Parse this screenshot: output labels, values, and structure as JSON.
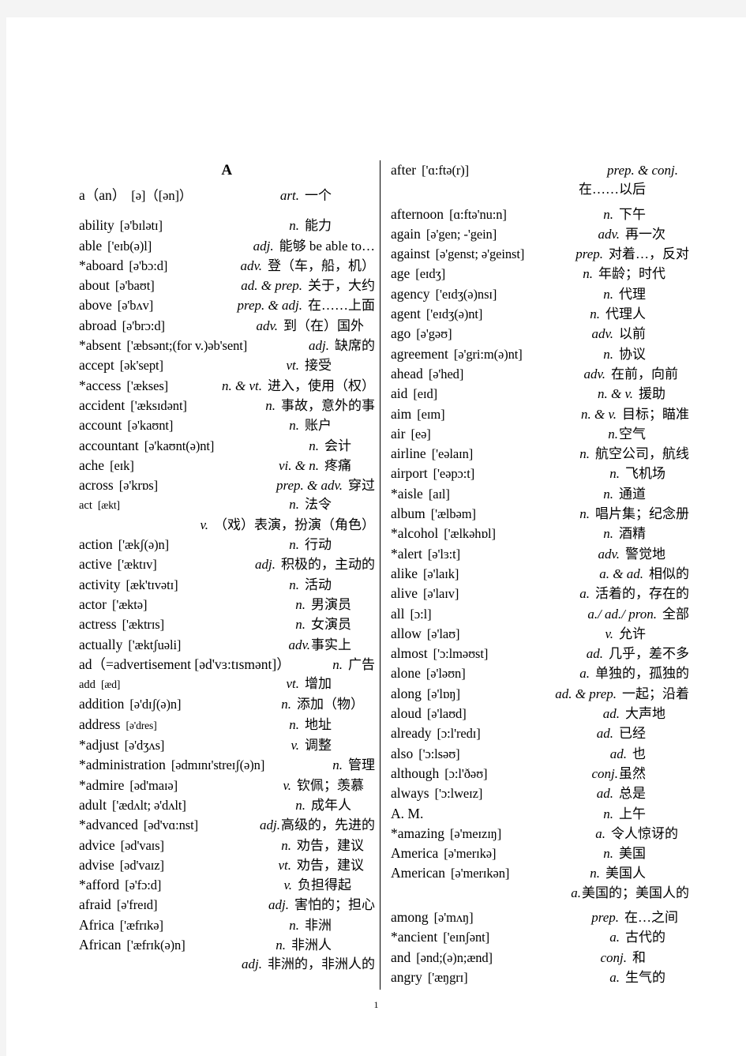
{
  "page": {
    "section_letter": "A",
    "page_number": "1"
  },
  "left_column": [
    {
      "word": "a（an）",
      "phonetic": "[ə]（[ən]）",
      "pos": "art.",
      "def": "一个",
      "spacing": "none",
      "tail_pad": "pad-right-55"
    },
    {
      "word": "ability",
      "phonetic": "[ə'bɪlətɪ]",
      "pos": "n.",
      "def": "能力",
      "spacing": "gap-top",
      "tail_pad": "pad-right-55"
    },
    {
      "word": "able",
      "phonetic": "['eɪb(ə)l]",
      "pos": "adj.",
      "def": "能够 be able to…",
      "spacing": "none",
      "tail_pad": ""
    },
    {
      "word": "*aboard",
      "phonetic": "[ə'bɔ:d]",
      "pos": "adv.",
      "def": "登（车，船，机）",
      "spacing": "none",
      "tail_pad": ""
    },
    {
      "word": "about",
      "phonetic": "[ə'baʊt]",
      "pos": "ad. & prep.",
      "def": "关于，大约",
      "spacing": "none",
      "tail_pad": ""
    },
    {
      "word": "above",
      "phonetic": "[ə'bʌv]",
      "pos": "prep. & adj.",
      "def": "在……上面",
      "spacing": "none",
      "tail_pad": ""
    },
    {
      "word": "abroad",
      "phonetic": "[ə'brɔ:d]",
      "pos": "adv.",
      "def": "到（在）国外",
      "spacing": "none",
      "tail_pad": "pad-right-14"
    },
    {
      "word": "*absent",
      "phonetic": "['æbsənt;(for v.)əb'sent]",
      "pos": "adj.",
      "def": "缺席的",
      "spacing": "none",
      "tail_pad": ""
    },
    {
      "word": "accept",
      "phonetic": "[ək'sept]",
      "pos": "vt.",
      "def": "接受",
      "spacing": "none",
      "tail_pad": "pad-right-55"
    },
    {
      "word": "*access",
      "phonetic": "['ækses]",
      "pos": "n. & vt.",
      "def": "进入，使用（权）",
      "spacing": "none",
      "tail_pad": ""
    },
    {
      "word": "accident",
      "phonetic": "['æksɪdənt]",
      "pos": "n.",
      "def": "事故，意外的事",
      "spacing": "none",
      "tail_pad": ""
    },
    {
      "word": "account",
      "phonetic": "[ə'kaʊnt]",
      "pos": "n.",
      "def": "账户",
      "spacing": "none",
      "tail_pad": "pad-right-55"
    },
    {
      "word": "accountant",
      "phonetic": "[ə'kaʊnt(ə)nt]",
      "pos": "n.",
      "def": "会计",
      "spacing": "none",
      "tail_pad": "pad-right-30"
    },
    {
      "word": "ache",
      "phonetic": "[eɪk]",
      "pos": "vi. & n.",
      "def": "疼痛",
      "spacing": "none",
      "tail_pad": "pad-right-30"
    },
    {
      "word": "across",
      "phonetic": "[ə'krɒs]",
      "pos": "prep. & adv.",
      "def": "穿过",
      "spacing": "none",
      "tail_pad": ""
    },
    {
      "word": "act",
      "phonetic": "[ækt]",
      "pos": "n.",
      "def": "法令",
      "spacing": "none",
      "small": true,
      "tail_pad": "pad-right-55"
    },
    {
      "continuation": true,
      "pos": "v.",
      "def": "（戏）表演，扮演（角色）",
      "spacing": "none"
    },
    {
      "word": "action",
      "phonetic": "['ækʃ(ə)n]",
      "pos": "n.",
      "def": "行动",
      "spacing": "none",
      "tail_pad": "pad-right-55"
    },
    {
      "word": "active",
      "phonetic": "['æktɪv]",
      "pos": "adj.",
      "def": "积极的，主动的",
      "spacing": "none",
      "tail_pad": ""
    },
    {
      "word": "activity",
      "phonetic": "[æk'tɪvətɪ]",
      "pos": "n.",
      "def": "活动",
      "spacing": "none",
      "tail_pad": "pad-right-55"
    },
    {
      "word": "actor",
      "phonetic": "['æktə]",
      "pos": "n.",
      "def": "男演员",
      "spacing": "none",
      "tail_pad": "pad-right-30"
    },
    {
      "word": "actress",
      "phonetic": "['æktrɪs]",
      "pos": "n.",
      "def": "女演员",
      "spacing": "none",
      "tail_pad": "pad-right-30"
    },
    {
      "word": "actually",
      "phonetic": "['æktʃuəli]",
      "pos": "adv.",
      "def": "事实上",
      "spacing": "none",
      "joined": true,
      "tail_pad": "pad-right-30"
    },
    {
      "word": "ad（=advertisement [əd'vɜ:tɪsmənt]）",
      "phonetic": "",
      "pos": "n.",
      "def": "广告",
      "spacing": "none",
      "wide": true,
      "tail_pad": ""
    },
    {
      "word": "add",
      "phonetic": "[æd]",
      "pos": "vt.",
      "def": "增加",
      "spacing": "none",
      "small": true,
      "tail_pad": "pad-right-55"
    },
    {
      "word": "addition",
      "phonetic": "[ə'dɪʃ(ə)n]",
      "pos": "n.",
      "def": "添加（物）",
      "spacing": "none",
      "tail_pad": "pad-right-14"
    },
    {
      "word": "address",
      "phonetic": "[ə'dres]",
      "pos": "n.",
      "def": "地址",
      "spacing": "none",
      "small_phon": true,
      "tail_pad": "pad-right-55"
    },
    {
      "word": "*adjust",
      "phonetic": "[ə'dʒʌs]",
      "pos": "v.",
      "def": "调整",
      "spacing": "none",
      "tail_pad": "pad-right-55"
    },
    {
      "word": "*administration",
      "phonetic": "[ədmɪnɪ'streɪʃ(ə)n]",
      "pos": "n.",
      "def": "管理",
      "spacing": "none",
      "tail_pad": ""
    },
    {
      "word": "*admire",
      "phonetic": "[əd'maɪə]",
      "pos": "v.",
      "def": "钦佩；羡慕",
      "spacing": "none",
      "tail_pad": "pad-right-14"
    },
    {
      "word": "adult",
      "phonetic": "['ædʌlt; ə'dʌlt]",
      "pos": "n.",
      "def": "成年人",
      "spacing": "none",
      "tail_pad": "pad-right-30"
    },
    {
      "word": "*advanced",
      "phonetic": "[əd'vɑ:nst]",
      "pos": "adj.",
      "def": "高级的，先进的",
      "spacing": "none",
      "joined": true,
      "tail_pad": ""
    },
    {
      "word": "advice",
      "phonetic": "[əd'vaɪs]",
      "pos": "n.",
      "def": "劝告，建议",
      "spacing": "none",
      "tail_pad": "pad-right-14"
    },
    {
      "word": "advise",
      "phonetic": "[əd'vaɪz]",
      "pos": "vt.",
      "def": "劝告，建议",
      "spacing": "none",
      "tail_pad": "pad-right-14"
    },
    {
      "word": "*afford",
      "phonetic": "[ə'fɔ:d]",
      "pos": "v.",
      "def": "负担得起",
      "spacing": "none",
      "tail_pad": "pad-right-30"
    },
    {
      "word": "afraid",
      "phonetic": "[ə'freɪd]",
      "pos": "adj.",
      "def": "害怕的；担心",
      "spacing": "none",
      "tail_pad": ""
    },
    {
      "word": "Africa",
      "phonetic": "['æfrɪkə]",
      "pos": "n.",
      "def": "非洲",
      "spacing": "none",
      "tail_pad": "pad-right-55"
    },
    {
      "word": "African",
      "phonetic": "['æfrɪk(ə)n]",
      "pos": "n.",
      "def": "非洲人",
      "spacing": "none",
      "tail_pad": "pad-right-55"
    },
    {
      "continuation": true,
      "pos": "adj.",
      "def": "非洲的，非洲人的",
      "spacing": "none",
      "align": "right"
    }
  ],
  "right_column": [
    {
      "word": "after",
      "phonetic": "['ɑ:ftə(r)]",
      "pos": "prep. & conj.",
      "def": "",
      "spacing": "none",
      "tail_pad": "pad-right-14"
    },
    {
      "continuation": true,
      "pos": "",
      "def": "在……以后",
      "spacing": "none",
      "align": "right",
      "cont_pad": "pad-right-55"
    },
    {
      "word": "afternoon",
      "phonetic": "[ɑ:ftə'nu:n]",
      "pos": "n.",
      "def": "下午",
      "spacing": "gap-small",
      "tail_pad": "pad-right-55"
    },
    {
      "word": "again",
      "phonetic": "[ə'gen; -'gein]",
      "pos": "adv.",
      "def": "再一次",
      "spacing": "none",
      "tail_pad": "pad-right-30"
    },
    {
      "word": "against",
      "phonetic": "[ə'genst; ə'geinst]",
      "pos": "prep.",
      "def": "对着…，反对",
      "spacing": "none",
      "tail_pad": ""
    },
    {
      "word": "age",
      "phonetic": "[eɪdʒ]",
      "pos": "n.",
      "def": "年龄；时代",
      "spacing": "none",
      "tail_pad": "pad-right-30"
    },
    {
      "word": "agency",
      "phonetic": "['eɪdʒ(ə)nsɪ]",
      "pos": "n.",
      "def": "代理",
      "spacing": "none",
      "tail_pad": "pad-right-55"
    },
    {
      "word": "agent",
      "phonetic": "['eɪdʒ(ə)nt]",
      "pos": "n.",
      "def": "代理人",
      "spacing": "none",
      "tail_pad": "pad-right-55"
    },
    {
      "word": "ago",
      "phonetic": "[ə'gəʊ]",
      "pos": "adv.",
      "def": "以前",
      "spacing": "none",
      "tail_pad": "pad-right-55"
    },
    {
      "word": "agreement",
      "phonetic": "[ə'gri:m(ə)nt]",
      "pos": "n.",
      "def": "协议",
      "spacing": "none",
      "tail_pad": "pad-right-55"
    },
    {
      "word": "ahead",
      "phonetic": "[ə'hed]",
      "pos": "adv.",
      "def": "在前，向前",
      "spacing": "none",
      "tail_pad": "pad-right-14"
    },
    {
      "word": "aid",
      "phonetic": "[eɪd]",
      "pos": "n. & v.",
      "def": "援助",
      "spacing": "none",
      "tail_pad": "pad-right-30"
    },
    {
      "word": "aim",
      "phonetic": "[eɪm]",
      "pos": "n. & v.",
      "def": "目标；瞄准",
      "spacing": "none",
      "tail_pad": ""
    },
    {
      "word": "air",
      "phonetic": "[eə]",
      "pos": "n.",
      "def": "空气",
      "spacing": "none",
      "joined": true,
      "tail_pad": "pad-right-55"
    },
    {
      "word": "airline",
      "phonetic": "['eəlaɪn]",
      "pos": "n.",
      "def": "航空公司，航线",
      "spacing": "none",
      "tail_pad": ""
    },
    {
      "word": "airport",
      "phonetic": "['eəpɔ:t]",
      "pos": "n.",
      "def": "飞机场",
      "spacing": "none",
      "tail_pad": "pad-right-30"
    },
    {
      "word": "*aisle",
      "phonetic": "[aɪl]",
      "pos": "n.",
      "def": "通道",
      "spacing": "none",
      "tail_pad": "pad-right-55"
    },
    {
      "word": "album",
      "phonetic": "['ælbəm]",
      "pos": "n.",
      "def": "唱片集；纪念册",
      "spacing": "none",
      "tail_pad": ""
    },
    {
      "word": "*alcohol",
      "phonetic": "['ælkəhɒl]",
      "pos": "n.",
      "def": "酒精",
      "spacing": "none",
      "tail_pad": "pad-right-55"
    },
    {
      "word": "*alert",
      "phonetic": "[ə'lɜ:t]",
      "pos": "adv.",
      "def": "警觉地",
      "spacing": "none",
      "tail_pad": "pad-right-30"
    },
    {
      "word": "alike",
      "phonetic": "[ə'laɪk]",
      "pos": "a. & ad.",
      "def": "相似的",
      "spacing": "none",
      "tail_pad": ""
    },
    {
      "word": "alive",
      "phonetic": "[ə'laɪv]",
      "pos": "a.",
      "def": "活着的，存在的",
      "spacing": "none",
      "tail_pad": ""
    },
    {
      "word": "all",
      "phonetic": "[ɔ:l]",
      "pos": "a./ ad./ pron.",
      "def": "全部",
      "spacing": "none",
      "tail_pad": ""
    },
    {
      "word": "allow",
      "phonetic": "[ə'laʊ]",
      "pos": "v.",
      "def": "允许",
      "spacing": "none",
      "tail_pad": "pad-right-55"
    },
    {
      "word": "almost",
      "phonetic": "['ɔ:lməʊst]",
      "pos": "ad.",
      "def": "几乎，差不多",
      "spacing": "none",
      "tail_pad": ""
    },
    {
      "word": "alone",
      "phonetic": "[ə'ləʊn]",
      "pos": "a.",
      "def": "单独的，孤独的",
      "spacing": "none",
      "tail_pad": ""
    },
    {
      "word": "along",
      "phonetic": "[ə'lɒŋ]",
      "pos": "ad. & prep.",
      "def": "一起；沿着",
      "spacing": "none",
      "tail_pad": ""
    },
    {
      "word": "aloud",
      "phonetic": "[ə'laʊd]",
      "pos": "ad.",
      "def": "大声地",
      "spacing": "none",
      "tail_pad": "pad-right-30"
    },
    {
      "word": "already",
      "phonetic": "[ɔ:l'redɪ]",
      "pos": "ad.",
      "def": "已经",
      "spacing": "none",
      "tail_pad": "pad-right-55"
    },
    {
      "word": "also",
      "phonetic": "['ɔ:lsəʊ]",
      "pos": "ad.",
      "def": "也",
      "spacing": "none",
      "tail_pad": "pad-right-55"
    },
    {
      "word": "although",
      "phonetic": "[ɔ:l'ðəʊ]",
      "pos": "conj.",
      "def": "虽然",
      "spacing": "none",
      "joined": true,
      "tail_pad": "pad-right-55"
    },
    {
      "word": "always",
      "phonetic": "['ɔ:lweɪz]",
      "pos": "ad.",
      "def": "总是",
      "spacing": "none",
      "tail_pad": "pad-right-55"
    },
    {
      "word": "A. M.",
      "phonetic": "",
      "pos": "n.",
      "def": "上午",
      "spacing": "none",
      "tail_pad": "pad-right-55"
    },
    {
      "word": "*amazing",
      "phonetic": "[ə'meɪzɪŋ]",
      "pos": "a.",
      "def": "令人惊讶的",
      "spacing": "none",
      "tail_pad": "pad-right-14"
    },
    {
      "word": "America",
      "phonetic": "[ə'merɪkə]",
      "pos": "n.",
      "def": "美国",
      "spacing": "none",
      "tail_pad": "pad-right-55"
    },
    {
      "word": "American",
      "phonetic": "[ə'merɪkən]",
      "pos": "n.",
      "def": "美国人",
      "spacing": "none",
      "tail_pad": "pad-right-55"
    },
    {
      "continuation": true,
      "pos": "a.",
      "def": "美国的；美国人的",
      "spacing": "none",
      "align": "right",
      "joined": true
    },
    {
      "word": "among",
      "phonetic": "[ə'mʌŋ]",
      "pos": "prep.",
      "def": "在…之间",
      "spacing": "gap-small",
      "tail_pad": "pad-right-14"
    },
    {
      "word": "*ancient",
      "phonetic": "['eɪnʃənt]",
      "pos": "a.",
      "def": "古代的",
      "spacing": "none",
      "tail_pad": "pad-right-30"
    },
    {
      "word": "and",
      "phonetic": "[ənd;(ə)n;ænd]",
      "pos": "conj.",
      "def": "和",
      "spacing": "none",
      "tail_pad": "pad-right-55"
    },
    {
      "word": "angry",
      "phonetic": "['æŋgrɪ]",
      "pos": "a.",
      "def": "生气的",
      "spacing": "none",
      "tail_pad": "pad-right-30"
    }
  ]
}
